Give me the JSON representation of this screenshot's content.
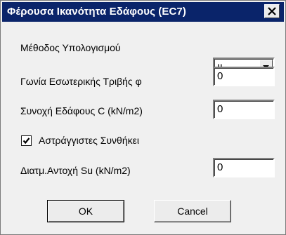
{
  "window": {
    "title": "Φέρουσα Ικανότητα Εδάφους (EC7)"
  },
  "fields": {
    "method": {
      "label": "Μέθοδος Υπολογισμού",
      "value": "II"
    },
    "friction_angle": {
      "label": "Γωνία Εσωτερικής Τριβής φ",
      "value": "0"
    },
    "cohesion": {
      "label": "Συνοχή Εδάφους C (kN/m2)",
      "value": "0"
    },
    "undrained": {
      "label": "Αστράγγιστες Συνθήκει",
      "checked": true
    },
    "undrained_strength": {
      "label": "Διατμ.Αντοχή Su (kN/m2)",
      "value": "0"
    }
  },
  "buttons": {
    "ok": "OK",
    "cancel": "Cancel"
  },
  "colors": {
    "titlebar": "#0a246a",
    "dialog_bg": "#f0f0f0"
  },
  "icons": {
    "close": "close-icon",
    "dropdown": "chevron-down-icon",
    "check": "checkmark-icon"
  }
}
